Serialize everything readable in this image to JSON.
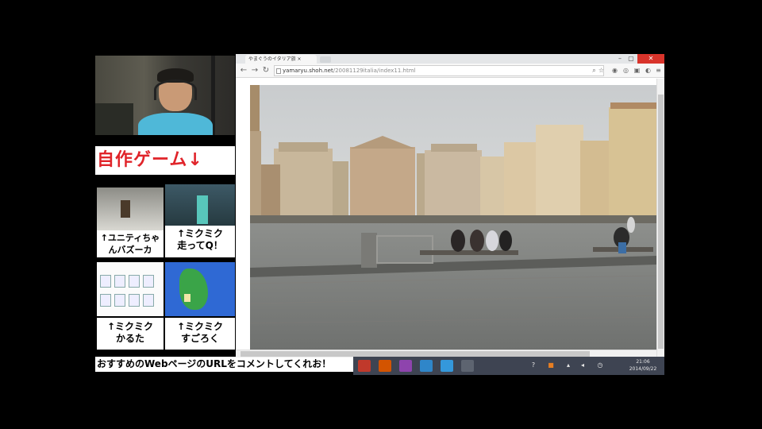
{
  "overlay": {
    "banner_title": "自作ゲーム↓",
    "games": [
      {
        "label": "↑ユニティちゃ\nんバズーカ",
        "icon": "unity-chan-game-thumbnail"
      },
      {
        "label": "↑ミクミク\n走ってQ！",
        "icon": "miku-run-game-thumbnail"
      },
      {
        "label": "↑ミクミク\nかるた",
        "icon": "miku-karuta-game-thumbnail"
      },
      {
        "label": "↑ミクミク\nすごろく",
        "icon": "miku-sugoroku-game-thumbnail"
      }
    ],
    "bottom_message": "おすすめのWebページのURLをコメントしてくれお！"
  },
  "browser": {
    "tab_title": "やまぐうのイタリア旅 ×",
    "url_host": "yamaryu.shoh.net",
    "url_path": "/20081129italia/index11.html",
    "accent_close": "#d9342b"
  },
  "taskbar": {
    "clock_time": "21:06",
    "clock_date": "2014/09/22",
    "app_icons": [
      "browser-icon",
      "folder-icon",
      "media-icon",
      "network-icon",
      "app-icon",
      "window-icon"
    ],
    "tray_icons": [
      "help-icon",
      "shield-icon",
      "network-tray-icon",
      "volume-icon",
      "clock-tray-icon"
    ]
  }
}
